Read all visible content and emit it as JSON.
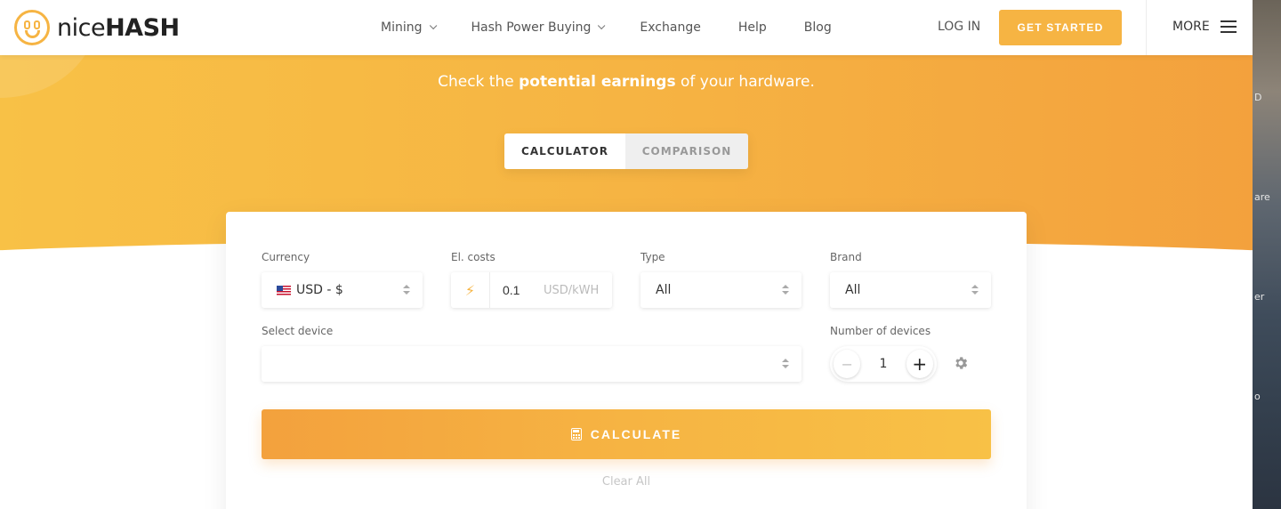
{
  "brand": {
    "logo_text_light": "nice",
    "logo_text_bold": "HASH"
  },
  "nav": {
    "links": [
      {
        "label": "Mining",
        "has_dropdown": true
      },
      {
        "label": "Hash Power Buying",
        "has_dropdown": true
      },
      {
        "label": "Exchange",
        "has_dropdown": false
      },
      {
        "label": "Help",
        "has_dropdown": false
      },
      {
        "label": "Blog",
        "has_dropdown": false
      }
    ],
    "login_label": "LOG IN",
    "get_started_label": "GET STARTED",
    "more_label": "MORE"
  },
  "hero": {
    "subtitle_pre": "Check the ",
    "subtitle_bold": "potential earnings",
    "subtitle_post": " of your hardware."
  },
  "tabs": [
    {
      "label": "CALCULATOR",
      "active": true
    },
    {
      "label": "COMPARISON",
      "active": false
    }
  ],
  "form": {
    "currency": {
      "label": "Currency",
      "value": "USD - $"
    },
    "el_costs": {
      "label": "El. costs",
      "value": "0.1",
      "unit": "USD/kWH"
    },
    "type": {
      "label": "Type",
      "value": "All"
    },
    "brand": {
      "label": "Brand",
      "value": "All"
    },
    "device": {
      "label": "Select device",
      "value": ""
    },
    "num_devices": {
      "label": "Number of devices",
      "value": "1",
      "minus": "−",
      "plus": "+"
    },
    "calculate_label": "CALCULATE",
    "clear_label": "Clear All"
  },
  "edge_strip": {
    "fragments": [
      "D",
      "are",
      "er",
      "o"
    ]
  },
  "colors": {
    "accent": "#f6b443",
    "accent_dark": "#f3a13d",
    "accent_light": "#f8c146"
  }
}
